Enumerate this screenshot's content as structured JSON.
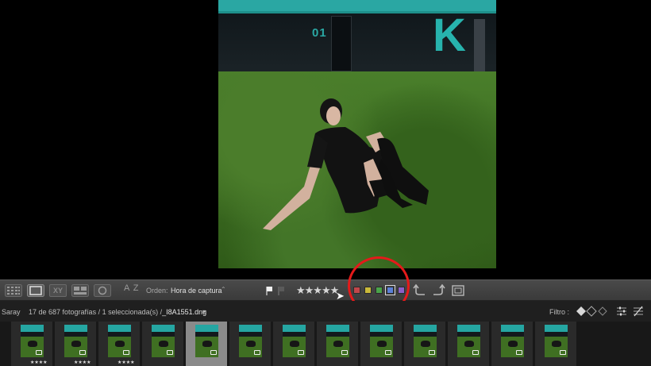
{
  "preview": {
    "photo_texts": {
      "door_number": "01",
      "building_letter": "K"
    }
  },
  "toolbar": {
    "sort_icon": "A Z",
    "sort_label": "Orden:",
    "sort_value": "Hora de captura",
    "sort_chevron": "⌃",
    "stars": "★★★★★",
    "color_labels": [
      {
        "name": "red",
        "color": "#c0464a"
      },
      {
        "name": "yellow",
        "color": "#c9b93a"
      },
      {
        "name": "green",
        "color": "#4aa34a"
      },
      {
        "name": "blue",
        "color": "#5b7fd6"
      },
      {
        "name": "purple",
        "color": "#8a5fc9"
      }
    ],
    "selected_color": "blue",
    "highlight_color": "#e41a1a"
  },
  "infobar": {
    "breadcrumb": "Saray",
    "count_text": "17 de 687 fotografías / 1 seleccionada(s) /",
    "filename": "_I8A1551.dng",
    "filename_chevron": "▾",
    "filter_label": "Filtro :"
  },
  "filmstrip": {
    "frames": [
      {
        "stars": "★★★★",
        "selected": false
      },
      {
        "stars": "★★★★",
        "selected": false
      },
      {
        "stars": "★★★★",
        "selected": false
      },
      {
        "stars": "",
        "selected": false
      },
      {
        "stars": "",
        "selected": true
      },
      {
        "stars": "",
        "selected": false
      },
      {
        "stars": "",
        "selected": false
      },
      {
        "stars": "",
        "selected": false
      },
      {
        "stars": "",
        "selected": false
      },
      {
        "stars": "",
        "selected": false
      },
      {
        "stars": "",
        "selected": false
      },
      {
        "stars": "",
        "selected": false
      },
      {
        "stars": "",
        "selected": false
      }
    ]
  }
}
